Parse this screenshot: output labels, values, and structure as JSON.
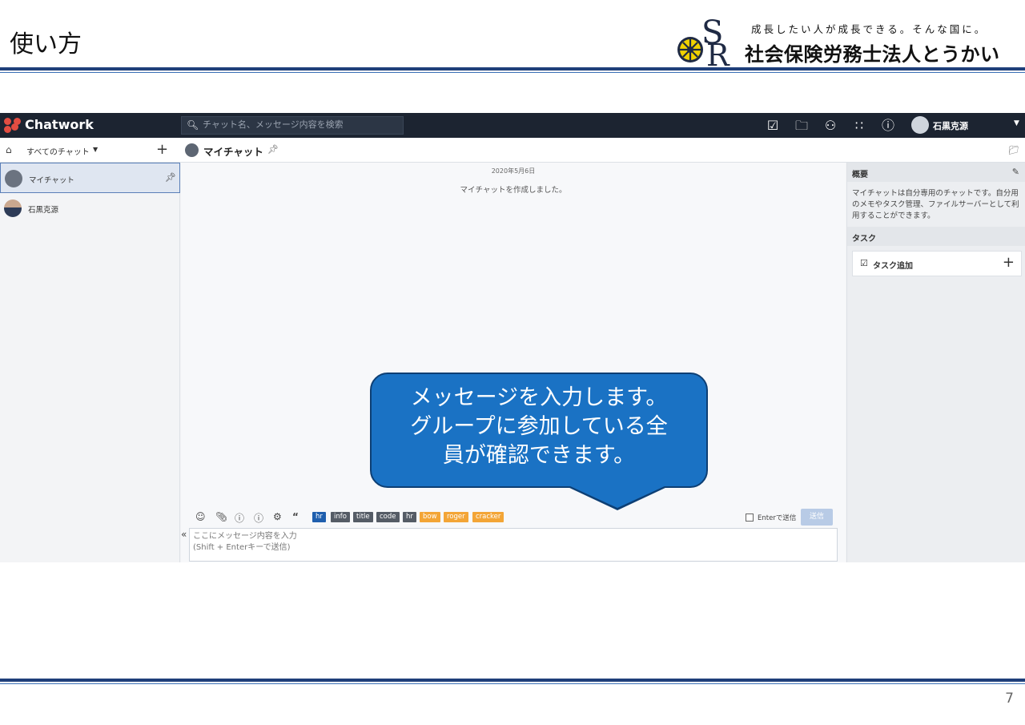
{
  "slide": {
    "title": "使い方",
    "page_number": "7",
    "brand": {
      "logo_letters": "SR",
      "tagline": "成長したい人が成長できる。そんな国に。",
      "name": "社会保険労務士法人とうかい"
    }
  },
  "app": {
    "name": "Chatwork",
    "search_placeholder": "チャット名、メッセージ内容を検索",
    "user_name": "石黒克源",
    "toolbar_icons": [
      "task-check-icon",
      "folder-icon",
      "contact-add-icon",
      "apps-grid-icon",
      "info-icon"
    ],
    "chat_filter": "すべてのチャット",
    "rooms": [
      {
        "label": "マイチャット",
        "active": true,
        "pinned": true
      },
      {
        "label": "石黒克源",
        "active": false,
        "pinned": false
      }
    ],
    "room_title": "マイチャット",
    "timeline": {
      "date": "2020年5月6日",
      "message": "マイチャットを作成しました。"
    },
    "right_panel": {
      "summary_header": "概要",
      "summary_text": "マイチャットは自分専用のチャットです。自分用のメモやタスク管理、ファイルサーバーとして利用することができます。",
      "task_header": "タスク",
      "task_add_label": "タスク追加"
    },
    "composer_tags": [
      {
        "label": "hr",
        "style": "blue"
      },
      {
        "label": "info",
        "style": "dark"
      },
      {
        "label": "title",
        "style": "dark"
      },
      {
        "label": "code",
        "style": "dark"
      },
      {
        "label": "hr",
        "style": "dark"
      },
      {
        "label": "bow",
        "style": "orange"
      },
      {
        "label": "roger",
        "style": "orange"
      },
      {
        "label": "cracker",
        "style": "orange"
      }
    ],
    "enter_send_label": "Enterで送信",
    "send_button": "送信",
    "input_placeholder": "ここにメッセージ内容を入力\n(Shift + Enterキーで送信)"
  },
  "callout": {
    "line1": "メッセージを入力します。",
    "line2": "グループに参加している全",
    "line3": "員が確認できます。"
  },
  "colors": {
    "topbar": "#1c2431",
    "callout": "#1a72c4",
    "rule": "#1f3f7a",
    "tag_orange": "#f3a536"
  }
}
